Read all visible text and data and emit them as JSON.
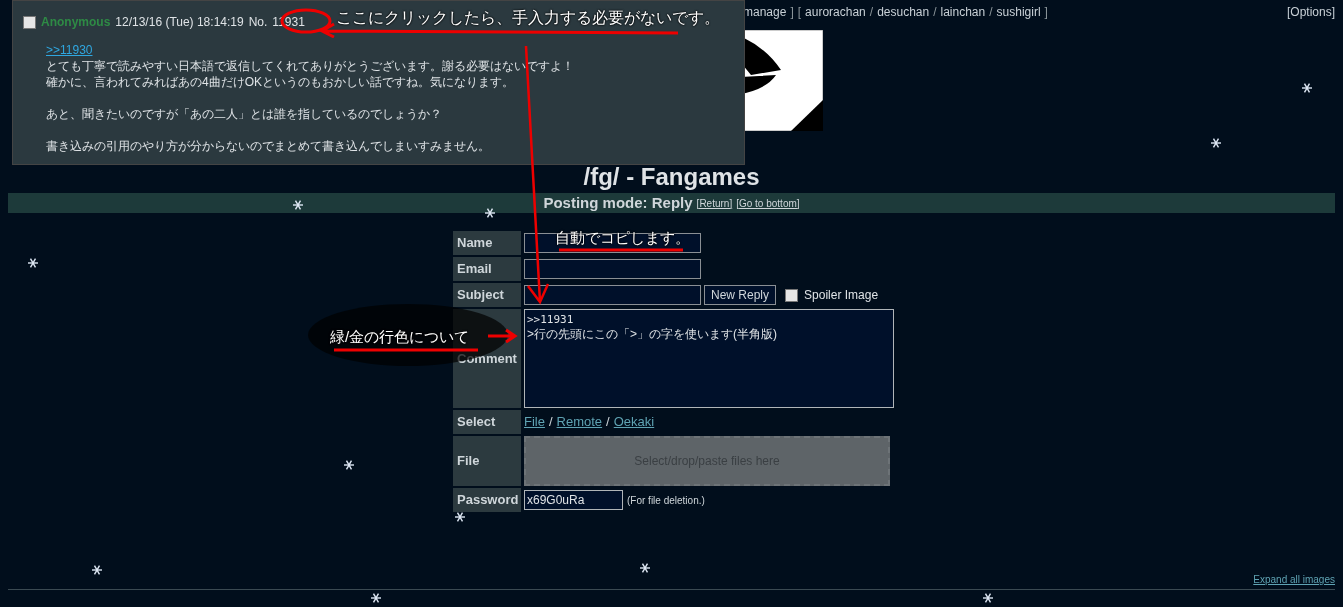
{
  "top_nav": {
    "partial_link": "manage",
    "close_bracket": "]",
    "open_bracket": "[",
    "links": [
      "aurorachan",
      "desuchan",
      "lainchan",
      "sushigirl"
    ],
    "separator": "/",
    "end_bracket": "]",
    "options": "[Options]"
  },
  "board_title": "/fg/ - Fangames",
  "posting_mode": {
    "label": "Posting mode: Reply",
    "links": [
      "[Return]",
      "[Go to bottom]"
    ]
  },
  "form": {
    "name": {
      "label": "Name"
    },
    "email": {
      "label": "Email"
    },
    "subject": {
      "label": "Subject",
      "button": "New Reply",
      "spoiler": {
        "label": "Spoiler Image",
        "checked": false
      }
    },
    "comment": {
      "label": "Comment",
      "lines": [
        ">>11931",
        ">行の先頭にこの「>」の字を使います(半角版)"
      ]
    },
    "select": {
      "label": "Select",
      "links": [
        "File",
        "Remote",
        "Oekaki"
      ],
      "separator": "/"
    },
    "file": {
      "label": "File",
      "dropzone": "Select/drop/paste files here"
    },
    "password": {
      "label": "Password",
      "value": "x69G0uRa",
      "note": "(For file deletion.)"
    }
  },
  "expand_link": "Expand all images",
  "post_preview": {
    "checked": false,
    "name": "Anonymous",
    "date": "12/13/16 (Tue) 18:14:19",
    "no_label": "No.",
    "number": "11931",
    "quote": ">>11930",
    "paragraphs": [
      [
        "とても丁寧で読みやすい日本語で返信してくれてありがとうございます。謝る必要はないですよ！",
        "確かに、言われてみればあの4曲だけOKというのもおかしい話ですね。気になります。"
      ],
      [
        "あと、聞きたいのですが「あの二人」とは誰を指しているのでしょうか？"
      ],
      [
        "書き込みの引用のやり方が分からないのでまとめて書き込んでしまいすみません。"
      ]
    ]
  },
  "annotations": [
    "ここにクリックしたら、手入力する必要がないです。",
    "自動でコピします。",
    "緑/金の行色について"
  ]
}
